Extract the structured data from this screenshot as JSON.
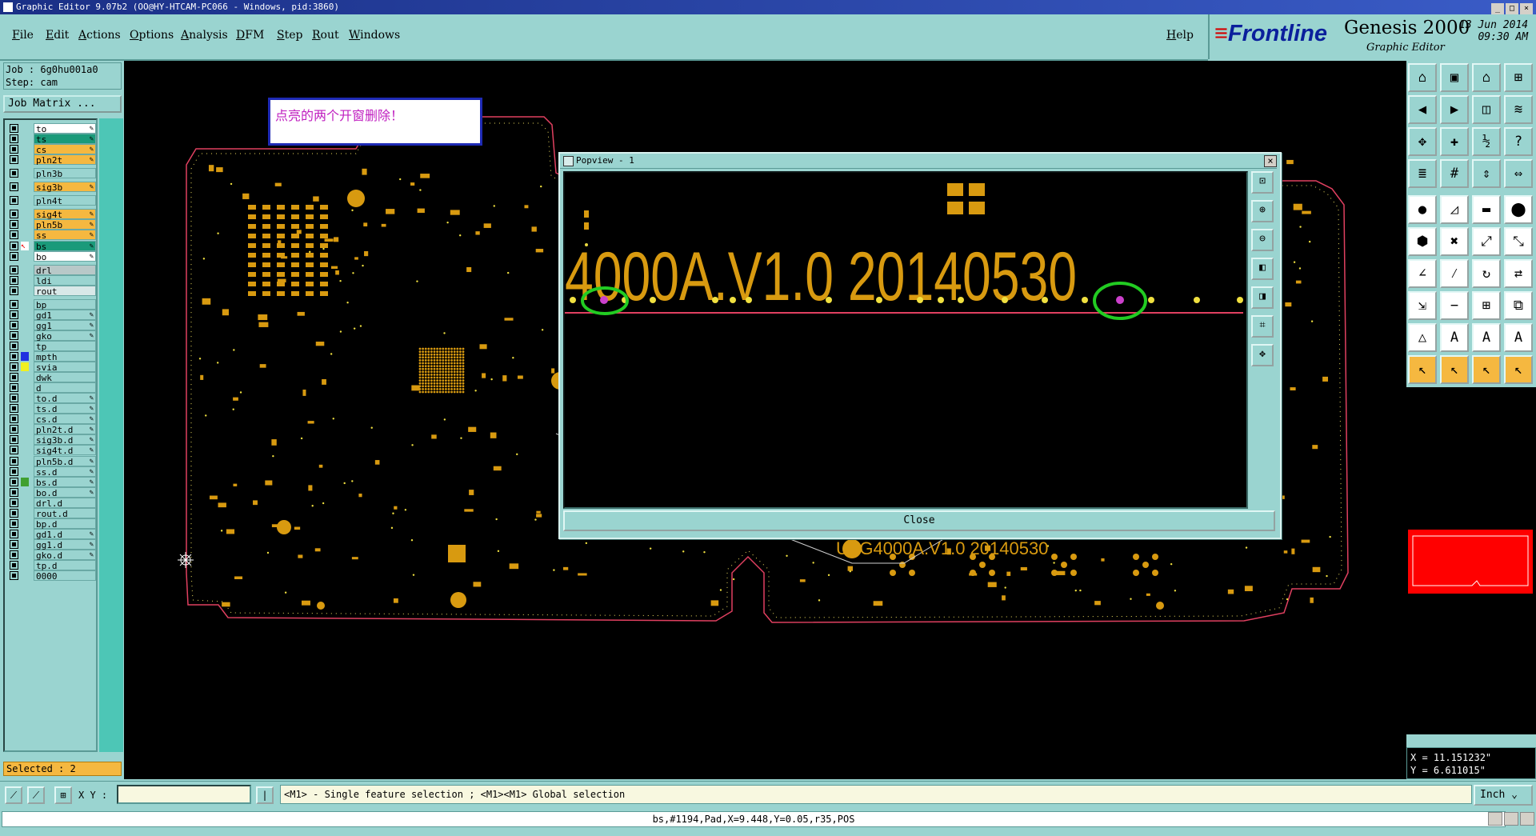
{
  "window": {
    "title": "Graphic Editor 9.07b2 (OO@HY-HTCAM-PC066 - Windows, pid:3860)"
  },
  "menu": {
    "items": [
      "File",
      "Edit",
      "Actions",
      "Options",
      "Analysis",
      "DFM",
      "Step",
      "Rout",
      "Windows"
    ],
    "help": "Help"
  },
  "brand": {
    "logo": "Frontline",
    "product": "Genesis 2000",
    "subtitle": "Graphic Editor",
    "date": "13 Jun 2014",
    "time": "09:30 AM"
  },
  "job": {
    "job_label": "Job : 6g0hu001a0",
    "step_label": "Step: cam",
    "matrix_button": "Job Matrix ..."
  },
  "layers": [
    {
      "name": "to",
      "color": "#ffffff",
      "edit": true
    },
    {
      "name": "ts",
      "color": "#1a9a7a",
      "edit": true
    },
    {
      "name": "cs",
      "color": "#f5b840",
      "edit": true
    },
    {
      "name": "pln2t",
      "color": "#f5b840",
      "edit": true
    },
    {
      "name": "pln3b",
      "color": "#9ad4d0",
      "edit": false
    },
    {
      "name": "sig3b",
      "color": "#f5b840",
      "edit": true
    },
    {
      "name": "pln4t",
      "color": "#9ad4d0",
      "edit": false
    },
    {
      "name": "sig4t",
      "color": "#f5b840",
      "edit": true
    },
    {
      "name": "pln5b",
      "color": "#f5b840",
      "edit": true
    },
    {
      "name": "ss",
      "color": "#f5b840",
      "edit": true
    },
    {
      "name": "bs",
      "color": "#1a9a7a",
      "edit": true
    },
    {
      "name": "bo",
      "color": "#ffffff",
      "edit": true
    },
    {
      "name": "drl",
      "color": "#b8c8c8",
      "edit": false
    },
    {
      "name": "ldi",
      "color": "#9ad4d0",
      "edit": false
    },
    {
      "name": "rout",
      "color": "#d8e8e8",
      "edit": false
    },
    {
      "name": "bp",
      "color": "#9ad4d0",
      "edit": false
    },
    {
      "name": "gd1",
      "color": "#9ad4d0",
      "edit": true
    },
    {
      "name": "gg1",
      "color": "#9ad4d0",
      "edit": true
    },
    {
      "name": "gko",
      "color": "#9ad4d0",
      "edit": true
    },
    {
      "name": "tp",
      "color": "#9ad4d0",
      "edit": false
    },
    {
      "name": "mpth",
      "color": "#9ad4d0",
      "edit": false
    },
    {
      "name": "svia",
      "color": "#9ad4d0",
      "edit": false
    },
    {
      "name": "dwk",
      "color": "#9ad4d0",
      "edit": false
    },
    {
      "name": "d",
      "color": "#9ad4d0",
      "edit": false
    },
    {
      "name": "to.d",
      "color": "#9ad4d0",
      "edit": true
    },
    {
      "name": "ts.d",
      "color": "#9ad4d0",
      "edit": true
    },
    {
      "name": "cs.d",
      "color": "#9ad4d0",
      "edit": true
    },
    {
      "name": "pln2t.d",
      "color": "#9ad4d0",
      "edit": true
    },
    {
      "name": "sig3b.d",
      "color": "#9ad4d0",
      "edit": true
    },
    {
      "name": "sig4t.d",
      "color": "#9ad4d0",
      "edit": true
    },
    {
      "name": "pln5b.d",
      "color": "#9ad4d0",
      "edit": true
    },
    {
      "name": "ss.d",
      "color": "#9ad4d0",
      "edit": true
    },
    {
      "name": "bs.d",
      "color": "#9ad4d0",
      "edit": true
    },
    {
      "name": "bo.d",
      "color": "#9ad4d0",
      "edit": true
    },
    {
      "name": "drl.d",
      "color": "#9ad4d0",
      "edit": false
    },
    {
      "name": "rout.d",
      "color": "#9ad4d0",
      "edit": false
    },
    {
      "name": "bp.d",
      "color": "#9ad4d0",
      "edit": false
    },
    {
      "name": "gd1.d",
      "color": "#9ad4d0",
      "edit": true
    },
    {
      "name": "gg1.d",
      "color": "#9ad4d0",
      "edit": true
    },
    {
      "name": "gko.d",
      "color": "#9ad4d0",
      "edit": true
    },
    {
      "name": "tp.d",
      "color": "#9ad4d0",
      "edit": false
    },
    {
      "name": "0000",
      "color": "#9ad4d0",
      "edit": false
    }
  ],
  "selected_label": "Selected : 2",
  "canvas": {
    "note": "点亮的两个开窗删除！",
    "board_text": "UTG4000A.V1.0  20140530"
  },
  "popview": {
    "title": "Popview - 1",
    "zoom_text": "4000A.V1.0  20140530",
    "close_button": "Close"
  },
  "coords": {
    "x": "X = 11.151232\"",
    "y": "Y = 6.611015\""
  },
  "bottom": {
    "xy_label": "X Y :",
    "xy_value": "",
    "hint": "<M1> - Single feature selection ; <M1><M1> Global selection",
    "units": "Inch"
  },
  "status": {
    "text": "bs,#1194,Pad,X=9.448,Y=0.05,r35,POS"
  },
  "colors": {
    "pad": "#d89a10",
    "panel": "#9ad4d0",
    "highlight": "#22cc22"
  }
}
